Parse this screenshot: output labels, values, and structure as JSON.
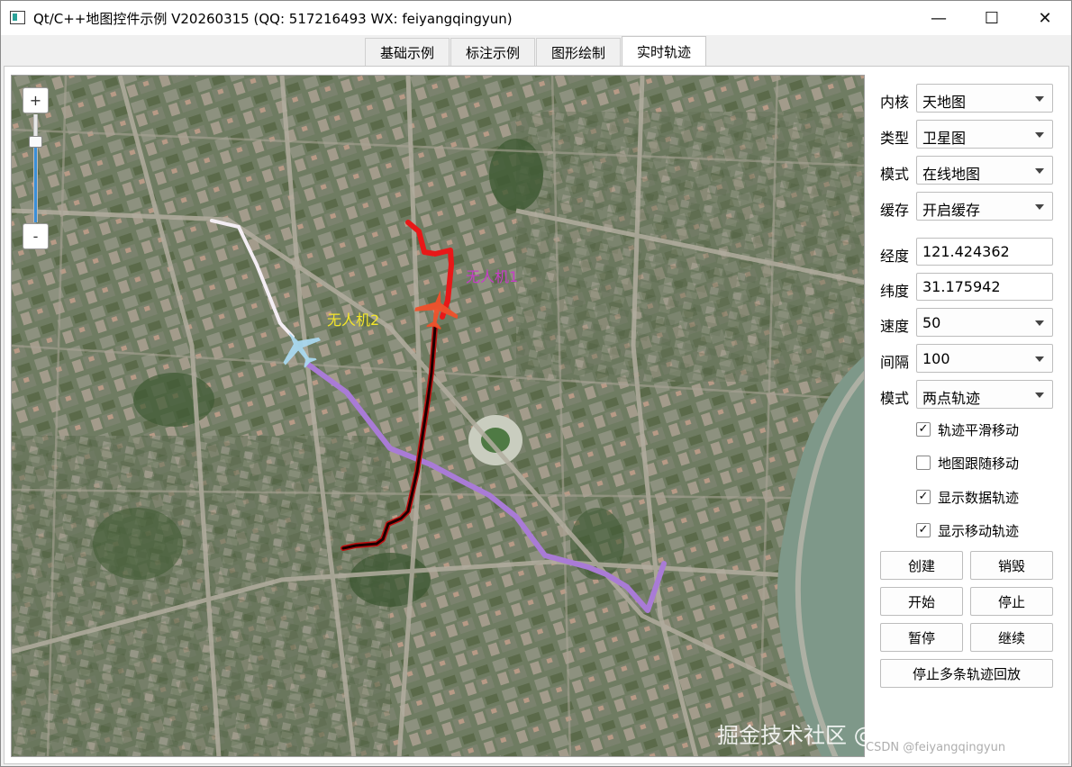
{
  "window": {
    "title": "Qt/C++地图控件示例 V20260315 (QQ: 517216493 WX: feiyangqingyun)",
    "controls": {
      "minimize": "—",
      "maximize": "☐",
      "close": "✕"
    }
  },
  "tabs": [
    {
      "label": "基础示例",
      "active": false
    },
    {
      "label": "标注示例",
      "active": false
    },
    {
      "label": "图形绘制",
      "active": false
    },
    {
      "label": "实时轨迹",
      "active": true
    }
  ],
  "map": {
    "zoom_in": "+",
    "zoom_out": "-",
    "zoom_level": 0.75,
    "labels": {
      "drone1": "无人机1",
      "drone2": "无人机2"
    },
    "watermark": "掘金技术社区 @ feiyangqingyun",
    "csdn_mark": "CSDN @feiyangqingyun",
    "colors": {
      "track_red": "#e81818",
      "track_black": "#1a0000",
      "track_purple": "#a97bd6",
      "track_white": "#ffffff",
      "plane_red": "#f0502a",
      "plane_blue": "#a9d8ef"
    }
  },
  "panel": {
    "kernel": {
      "label": "内核",
      "value": "天地图"
    },
    "type": {
      "label": "类型",
      "value": "卫星图"
    },
    "mode": {
      "label": "模式",
      "value": "在线地图"
    },
    "cache": {
      "label": "缓存",
      "value": "开启缓存"
    },
    "longitude": {
      "label": "经度",
      "value": "121.424362"
    },
    "latitude": {
      "label": "纬度",
      "value": "31.175942"
    },
    "speed": {
      "label": "速度",
      "value": "50"
    },
    "interval": {
      "label": "间隔",
      "value": "100"
    },
    "track_mode": {
      "label": "模式",
      "value": "两点轨迹"
    },
    "checks": [
      {
        "label": "轨迹平滑移动",
        "checked": true
      },
      {
        "label": "地图跟随移动",
        "checked": false
      },
      {
        "label": "显示数据轨迹",
        "checked": true
      },
      {
        "label": "显示移动轨迹",
        "checked": true
      }
    ],
    "buttons": {
      "create": "创建",
      "destroy": "销毁",
      "start": "开始",
      "stop": "停止",
      "pause": "暂停",
      "resume": "继续",
      "stop_multi": "停止多条轨迹回放"
    }
  }
}
